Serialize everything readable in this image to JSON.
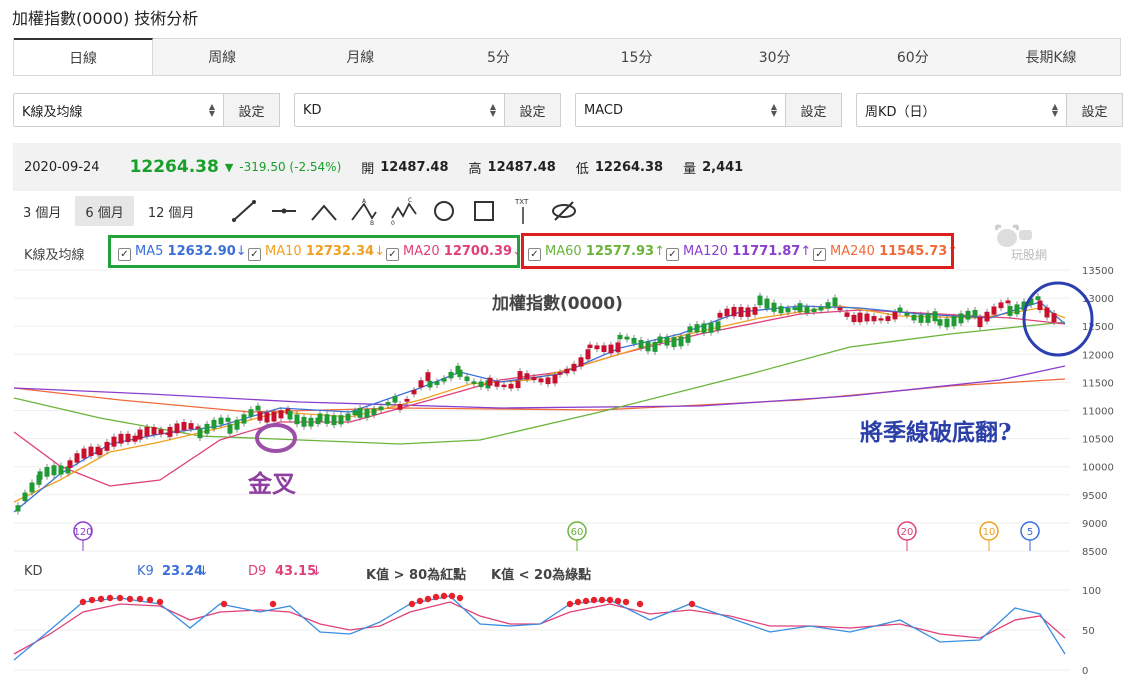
{
  "title": "加權指數(0000) 技術分析",
  "tabs": [
    "日線",
    "周線",
    "月線",
    "5分",
    "15分",
    "30分",
    "60分",
    "長期K線"
  ],
  "selectors": [
    {
      "value": "K線及均線",
      "button": "設定"
    },
    {
      "value": "KD",
      "button": "設定"
    },
    {
      "value": "MACD",
      "button": "設定"
    },
    {
      "value": "周KD（日）",
      "button": "設定"
    }
  ],
  "info": {
    "date": "2020-09-24",
    "price": "12264.38",
    "arrow": "▼",
    "change": "-319.50 (-2.54%)",
    "open_label": "開",
    "open": "12487.48",
    "high_label": "高",
    "high": "12487.48",
    "low_label": "低",
    "low": "12264.38",
    "vol_label": "量",
    "vol": "2,441"
  },
  "ranges": [
    "3 個月",
    "6 個月",
    "12 個月"
  ],
  "tools": [
    "line-tool-icon",
    "horizontal-line-icon",
    "angle-tool-icon",
    "abc-pattern-icon",
    "abcd-pattern-icon",
    "circle-tool-icon",
    "rectangle-tool-icon",
    "text-tool-icon",
    "hide-icon"
  ],
  "ma_label": "K線及均線",
  "ma": [
    {
      "name": "MA5",
      "value": "12632.90",
      "arrow": "↓",
      "color": "#3a6fd8"
    },
    {
      "name": "MA10",
      "value": "12732.34",
      "arrow": "↓",
      "color": "#f0a020"
    },
    {
      "name": "MA20",
      "value": "12700.39",
      "arrow": "↓",
      "color": "#e0407a"
    },
    {
      "name": "MA60",
      "value": "12577.93",
      "arrow": "↑",
      "color": "#6ab43a"
    },
    {
      "name": "MA120",
      "value": "11771.87",
      "arrow": "↑",
      "color": "#8a3fd0"
    },
    {
      "name": "MA240",
      "value": "11545.73",
      "arrow": "↑",
      "color": "#f06a3a"
    }
  ],
  "logo_text": "玩股網",
  "chart_title": "加權指數(0000)",
  "annotations": {
    "golden_cross": "金叉",
    "question": "將季線破底翻?"
  },
  "ma_markers": [
    "120",
    "60",
    "20",
    "10",
    "5"
  ],
  "kd": {
    "label": "KD",
    "k_label": "K9",
    "k_value": "23.24",
    "k_arrow": "↓",
    "d_label": "D9",
    "d_value": "43.15",
    "d_arrow": "↓",
    "rule_high": "K值 > 80為紅點",
    "rule_low": "K值 < 20為綠點"
  },
  "chart_data": {
    "type": "candlestick",
    "yticks": [
      13500,
      13000,
      12500,
      12000,
      11500,
      11000,
      10500,
      10000,
      9500,
      9000,
      8500
    ],
    "ylim": [
      8500,
      13500
    ],
    "kd_yticks": [
      100,
      50,
      0
    ],
    "kd_ylim": [
      0,
      100
    ]
  }
}
